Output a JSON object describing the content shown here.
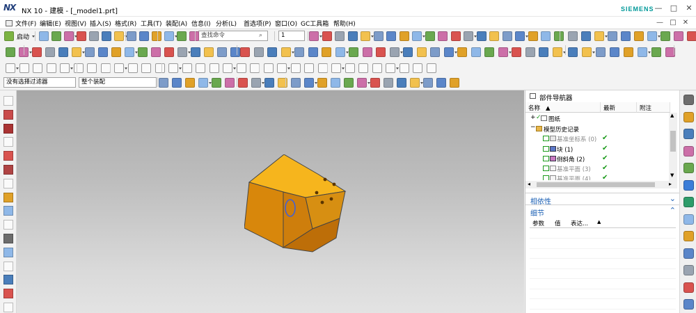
{
  "app": {
    "logo": "NX",
    "title": "NX 10 - 建模 - [_model1.prt]",
    "brand": "SIEMENS"
  },
  "window_buttons": [
    "—",
    "□",
    "✕"
  ],
  "menu": {
    "items": [
      "文件(F)",
      "编辑(E)",
      "视图(V)",
      "插入(S)",
      "格式(R)",
      "工具(T)",
      "装配(A)",
      "信息(I)",
      "分析(L)",
      "首选项(P)",
      "窗口(O)",
      "GC工具箱",
      "帮助(H)"
    ],
    "window_buttons": [
      "—",
      "□",
      "✕"
    ]
  },
  "toolbar": {
    "start_label": "启动",
    "search_placeholder": "查找命令",
    "layer_value": "1"
  },
  "filters": {
    "selection_filter": "没有选择过滤器",
    "assembly_scope": "整个装配"
  },
  "navigator": {
    "title": "部件导航器",
    "columns": [
      "名称",
      "最新",
      "附注"
    ],
    "rows": [
      {
        "label": "图纸",
        "checked": false,
        "latest": ""
      },
      {
        "label": "模型历史记录",
        "checked": false,
        "latest": ""
      },
      {
        "label": "基准坐标系 (0)",
        "checked": true,
        "latest": "✔",
        "dim": true
      },
      {
        "label": "块 (1)",
        "checked": true,
        "latest": "✔",
        "dim": false
      },
      {
        "label": "倒斜角 (2)",
        "checked": true,
        "latest": "✔",
        "dim": false
      },
      {
        "label": "基准平面 (3)",
        "checked": true,
        "latest": "✔",
        "dim": true
      },
      {
        "label": "基准平面 (4)",
        "checked": true,
        "latest": "✔",
        "dim": true
      }
    ],
    "dependency_title": "相依性",
    "details_title": "细节",
    "detail_columns": [
      "参数",
      "值",
      "表达..."
    ]
  },
  "colors": {
    "model_top": "#f6b51d",
    "model_left": "#d8870b",
    "model_front": "#ce7e0c",
    "model_right": "#bd6e08",
    "accent_blue": "#1a5fb4",
    "check_green": "#1a9a1a",
    "brand": "#009999"
  }
}
